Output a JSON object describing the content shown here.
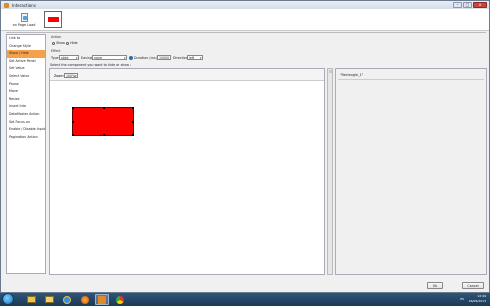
{
  "window": {
    "title": "Interactions",
    "buttons": {
      "minimize": "–",
      "maximize": "□",
      "close": "x"
    }
  },
  "toolbar": {
    "page_load_label": "on Page Load"
  },
  "sidebar": {
    "items": [
      {
        "label": "Link to"
      },
      {
        "label": "Change Style"
      },
      {
        "label": "Show / Hide"
      },
      {
        "label": "Set Active Panel"
      },
      {
        "label": "Set Value"
      },
      {
        "label": "Select Value"
      },
      {
        "label": "Pause"
      },
      {
        "label": "Move"
      },
      {
        "label": "Resize"
      },
      {
        "label": "Insert Into"
      },
      {
        "label": "DataMaster Action"
      },
      {
        "label": "Set Focus on"
      },
      {
        "label": "Enable / Disable Input"
      },
      {
        "label": "Pagination Action"
      }
    ],
    "active_index": 2
  },
  "action": {
    "group_label": "Action",
    "show_label": "Show",
    "hide_label": "Hide",
    "selected": "Show"
  },
  "effect": {
    "group_label": "Effect",
    "type_label": "Type",
    "type_value": "slide",
    "easing_label": "Easing",
    "easing_value": "none",
    "duration_label": "Duration (ms)",
    "duration_value": "15000",
    "direction_label": "Direction",
    "direction_value": "left"
  },
  "canvas": {
    "instruction": "Select the component you want to hide or show :",
    "zoom_label": "Zoom:",
    "zoom_value": "100%",
    "shape_color": "#ff0000"
  },
  "properties": {
    "title": "\"Rectangle_1\""
  },
  "footer": {
    "ok_label": "Ok",
    "cancel_label": "Cancel"
  },
  "taskbar": {
    "language": "ES",
    "time": "12:49",
    "date": "26/06/2013"
  }
}
